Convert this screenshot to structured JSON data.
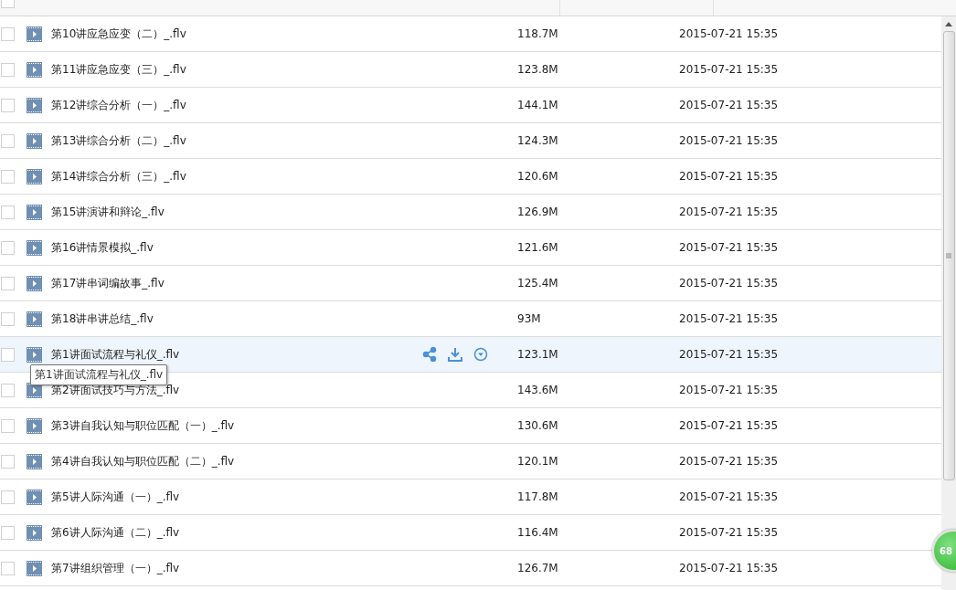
{
  "files": [
    {
      "name": "第10讲应急应变（二）_.flv",
      "size": "118.7M",
      "modified": "2015-07-21 15:35",
      "checked": false,
      "hovered": false
    },
    {
      "name": "第11讲应急应变（三）_.flv",
      "size": "123.8M",
      "modified": "2015-07-21 15:35",
      "checked": false,
      "hovered": false
    },
    {
      "name": "第12讲综合分析（一）_.flv",
      "size": "144.1M",
      "modified": "2015-07-21 15:35",
      "checked": false,
      "hovered": false
    },
    {
      "name": "第13讲综合分析（二）_.flv",
      "size": "124.3M",
      "modified": "2015-07-21 15:35",
      "checked": false,
      "hovered": false
    },
    {
      "name": "第14讲综合分析（三）_.flv",
      "size": "120.6M",
      "modified": "2015-07-21 15:35",
      "checked": false,
      "hovered": false
    },
    {
      "name": "第15讲演讲和辩论_.flv",
      "size": "126.9M",
      "modified": "2015-07-21 15:35",
      "checked": false,
      "hovered": false
    },
    {
      "name": "第16讲情景模拟_.flv",
      "size": "121.6M",
      "modified": "2015-07-21 15:35",
      "checked": false,
      "hovered": false
    },
    {
      "name": "第17讲串词编故事_.flv",
      "size": "125.4M",
      "modified": "2015-07-21 15:35",
      "checked": false,
      "hovered": false
    },
    {
      "name": "第18讲串讲总结_.flv",
      "size": "93M",
      "modified": "2015-07-21 15:35",
      "checked": false,
      "hovered": false
    },
    {
      "name": "第1讲面试流程与礼仪_.flv",
      "size": "123.1M",
      "modified": "2015-07-21 15:35",
      "checked": false,
      "hovered": true,
      "tooltip": "第1讲面试流程与礼仪_.flv"
    },
    {
      "name": "第2讲面试技巧与方法_.flv",
      "size": "143.6M",
      "modified": "2015-07-21 15:35",
      "checked": false,
      "hovered": false
    },
    {
      "name": "第3讲自我认知与职位匹配（一）_.flv",
      "size": "130.6M",
      "modified": "2015-07-21 15:35",
      "checked": false,
      "hovered": false
    },
    {
      "name": "第4讲自我认知与职位匹配（二）_.flv",
      "size": "120.1M",
      "modified": "2015-07-21 15:35",
      "checked": false,
      "hovered": false
    },
    {
      "name": "第5讲人际沟通（一）_.flv",
      "size": "117.8M",
      "modified": "2015-07-21 15:35",
      "checked": false,
      "hovered": false
    },
    {
      "name": "第6讲人际沟通（二）_.flv",
      "size": "116.4M",
      "modified": "2015-07-21 15:35",
      "checked": false,
      "hovered": false
    },
    {
      "name": "第7讲组织管理（一）_.flv",
      "size": "126.7M",
      "modified": "2015-07-21 15:35",
      "checked": false,
      "hovered": false
    }
  ],
  "header": {
    "checked": false
  },
  "badge": {
    "text": "68"
  }
}
